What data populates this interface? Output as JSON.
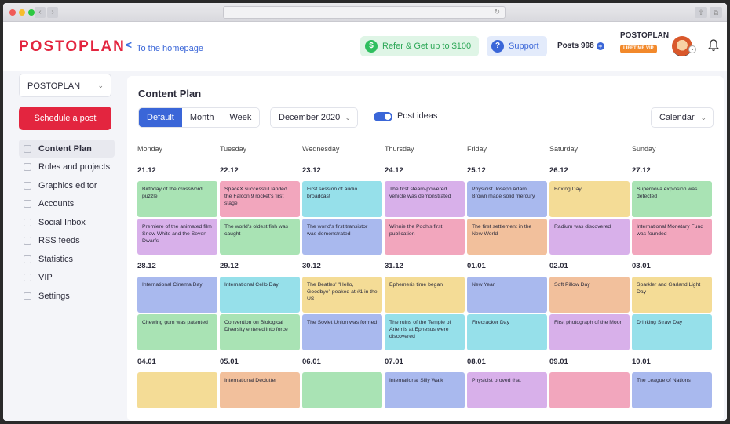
{
  "colors": {
    "green": "#a9e3b4",
    "pink": "#f2a6bd",
    "cyan": "#96e0ea",
    "purple": "#d8b0ea",
    "blue": "#a9b9ee",
    "yellow": "#f4dc96",
    "peach": "#f2c09c",
    "red": "#f0a3a3"
  },
  "header": {
    "logo": "POSTOPLAN",
    "home_link": "To the homepage",
    "refer": "Refer & Get up to $100",
    "support": "Support",
    "posts": "Posts 998",
    "account_name": "POSTOPLAN",
    "account_badge": "LIFETIME VIP"
  },
  "sidebar": {
    "workspace": "POSTOPLAN",
    "schedule_button": "Schedule a post",
    "items": [
      {
        "label": "Content Plan",
        "icon": "calendar-icon",
        "active": true
      },
      {
        "label": "Roles and projects",
        "icon": "folder-icon",
        "active": false
      },
      {
        "label": "Graphics editor",
        "icon": "image-icon",
        "active": false
      },
      {
        "label": "Accounts",
        "icon": "share-icon",
        "active": false
      },
      {
        "label": "Social Inbox",
        "icon": "inbox-icon",
        "active": false
      },
      {
        "label": "RSS feeds",
        "icon": "rss-icon",
        "active": false
      },
      {
        "label": "Statistics",
        "icon": "chart-icon",
        "active": false
      },
      {
        "label": "VIP",
        "icon": "crown-icon",
        "active": false
      },
      {
        "label": "Settings",
        "icon": "gear-icon",
        "active": false
      }
    ]
  },
  "main": {
    "title": "Content Plan",
    "views": [
      "Default",
      "Month",
      "Week"
    ],
    "month": "December 2020",
    "post_ideas": "Post ideas",
    "calendar_view": "Calendar",
    "days": [
      "Monday",
      "Tuesday",
      "Wednesday",
      "Thursday",
      "Friday",
      "Saturday",
      "Sunday"
    ],
    "weeks": [
      {
        "dates": [
          "21.12",
          "22.12",
          "23.12",
          "24.12",
          "25.12",
          "26.12",
          "27.12"
        ],
        "rows": [
          [
            {
              "text": "Birthday of the crossword puzzle",
              "color": "green"
            },
            {
              "text": "SpaceX successful landed the Falcon 9 rocket's first stage",
              "color": "pink"
            },
            {
              "text": "First session of audio broadcast",
              "color": "cyan"
            },
            {
              "text": "The first steam-powered vehicle was demonstrated",
              "color": "purple"
            },
            {
              "text": "Physicist Joseph Adam Brown made solid mercury",
              "color": "blue"
            },
            {
              "text": "Boxing Day",
              "color": "yellow"
            },
            {
              "text": "Supernova explosion was detected",
              "color": "green"
            }
          ],
          [
            {
              "text": "Premiere of the animated film Snow White and the Seven Dwarfs",
              "color": "purple"
            },
            {
              "text": "The world's oldest fish was caught",
              "color": "green"
            },
            {
              "text": "The world's first transistor was demonstrated",
              "color": "blue"
            },
            {
              "text": "Winnie the Pooh's first publication",
              "color": "pink"
            },
            {
              "text": "The first settlement in the New World",
              "color": "peach"
            },
            {
              "text": "Radium was discovered",
              "color": "purple"
            },
            {
              "text": "International Monetary Fund was founded",
              "color": "pink"
            }
          ]
        ]
      },
      {
        "dates": [
          "28.12",
          "29.12",
          "30.12",
          "31.12",
          "01.01",
          "02.01",
          "03.01"
        ],
        "rows": [
          [
            {
              "text": "International Cinema Day",
              "color": "blue"
            },
            {
              "text": "International Cello Day",
              "color": "cyan"
            },
            {
              "text": "The Beatles' \"Hello, Goodbye\" peaked at #1 in the US",
              "color": "yellow"
            },
            {
              "text": "Ephemeris time began",
              "color": "yellow"
            },
            {
              "text": "New Year",
              "color": "blue"
            },
            {
              "text": "Soft Pillow Day",
              "color": "peach"
            },
            {
              "text": "Sparkler and Garland Light Day",
              "color": "yellow"
            }
          ],
          [
            {
              "text": "Chewing gum was patented",
              "color": "green"
            },
            {
              "text": "Convention on Biological Diversity entered into force",
              "color": "green"
            },
            {
              "text": "The Soviet Union was formed",
              "color": "blue"
            },
            {
              "text": "The ruins of the Temple of Artemis at Ephesus were discovered",
              "color": "cyan"
            },
            {
              "text": "Firecracker Day",
              "color": "cyan"
            },
            {
              "text": "First photograph of the Moon",
              "color": "purple"
            },
            {
              "text": "Drinking Straw Day",
              "color": "cyan"
            }
          ]
        ]
      },
      {
        "dates": [
          "04.01",
          "05.01",
          "06.01",
          "07.01",
          "08.01",
          "09.01",
          "10.01"
        ],
        "rows": [
          [
            {
              "text": "",
              "color": "yellow"
            },
            {
              "text": "International Declutter",
              "color": "peach"
            },
            {
              "text": "",
              "color": "green"
            },
            {
              "text": "International Silly Walk",
              "color": "blue"
            },
            {
              "text": "Physicist proved that",
              "color": "purple"
            },
            {
              "text": "",
              "color": "pink"
            },
            {
              "text": "The League of Nations",
              "color": "blue"
            }
          ]
        ]
      }
    ]
  }
}
